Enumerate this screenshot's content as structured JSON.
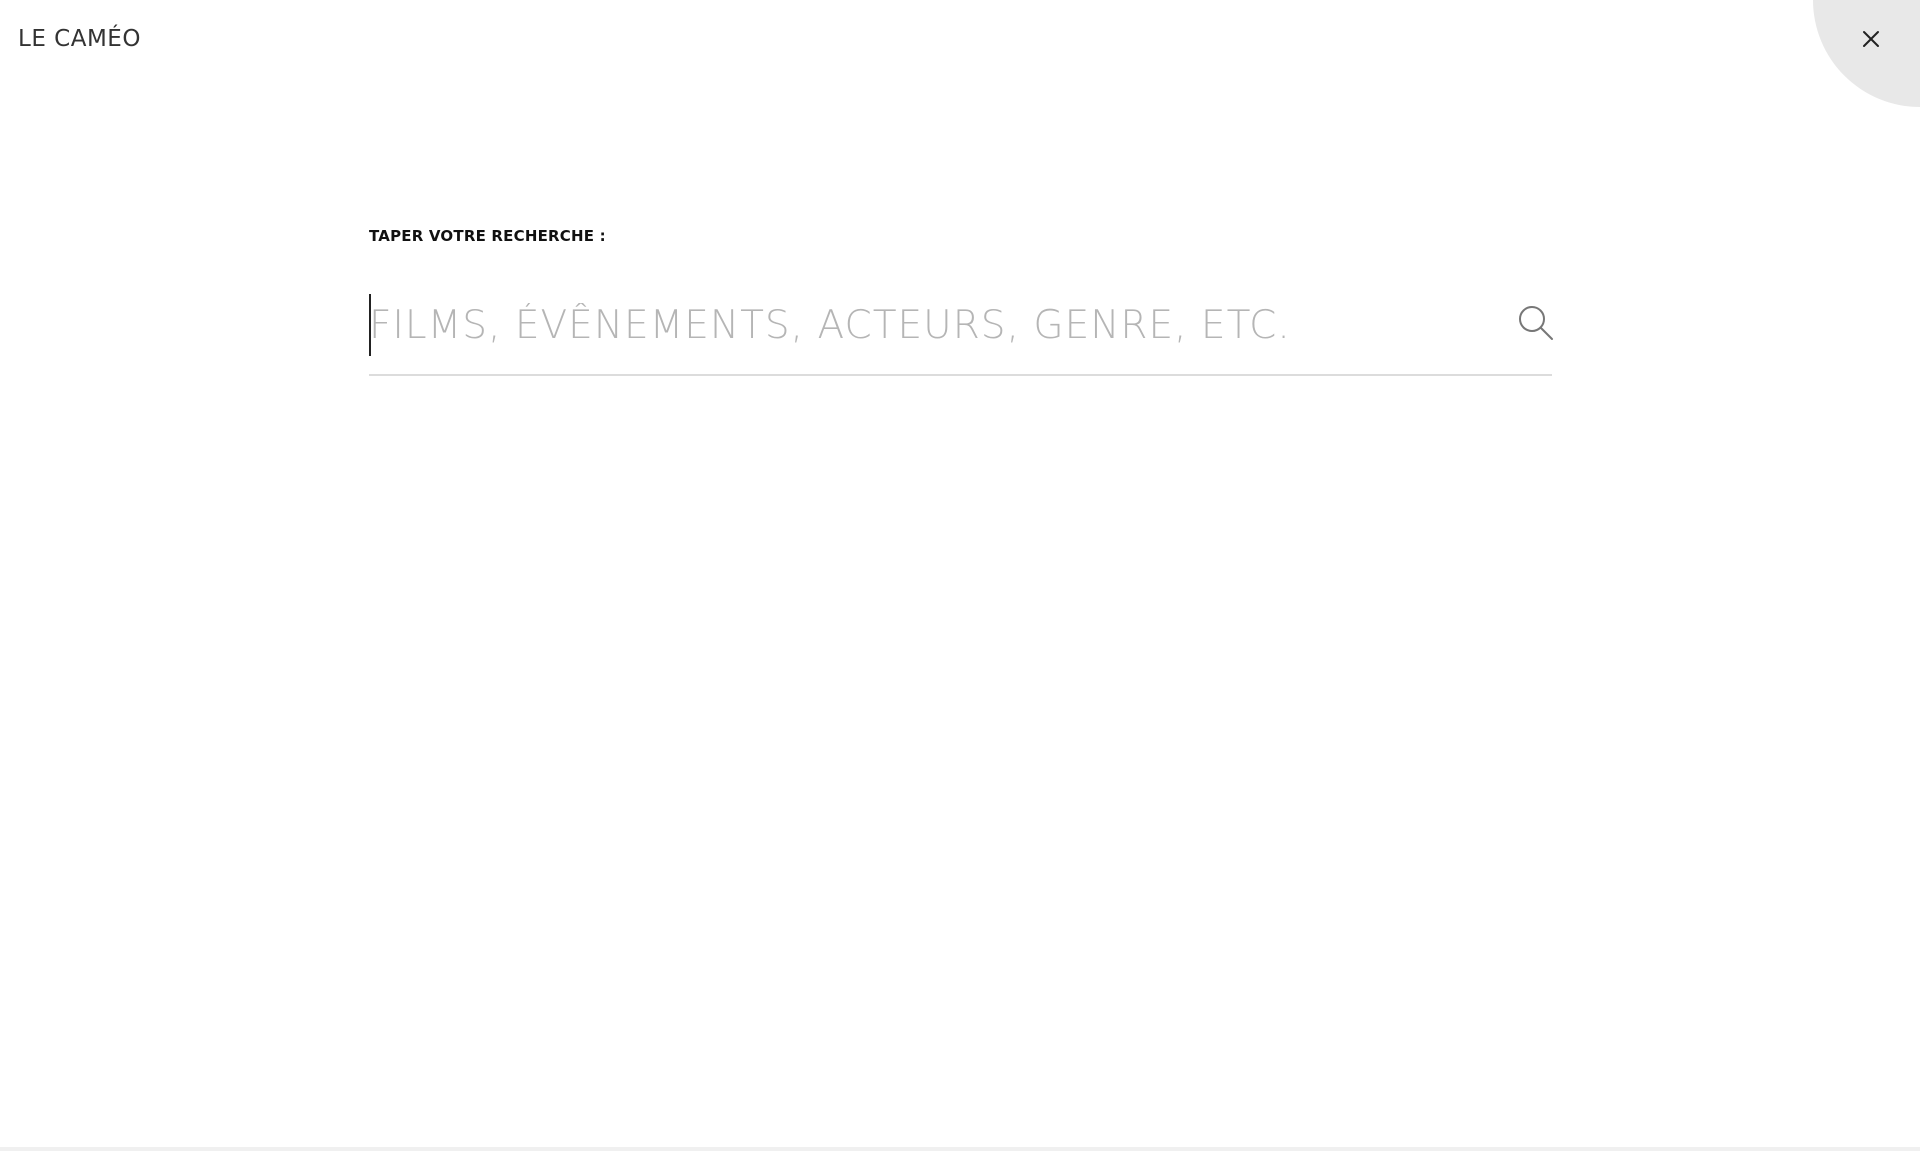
{
  "header": {
    "logo_text": "LE CAMÉO",
    "close_icon": "close-icon"
  },
  "search": {
    "label": "TAPER VOTRE RECHERCHE :",
    "placeholder": "FILMS, ÉVÊNEMENTS, ACTEURS, GENRE, ETC.",
    "value": "",
    "icon": "search-icon"
  },
  "colors": {
    "background": "#ffffff",
    "close_circle": "#e8e8e8",
    "placeholder": "#b5b5b5",
    "underline": "#dcdcdc"
  }
}
